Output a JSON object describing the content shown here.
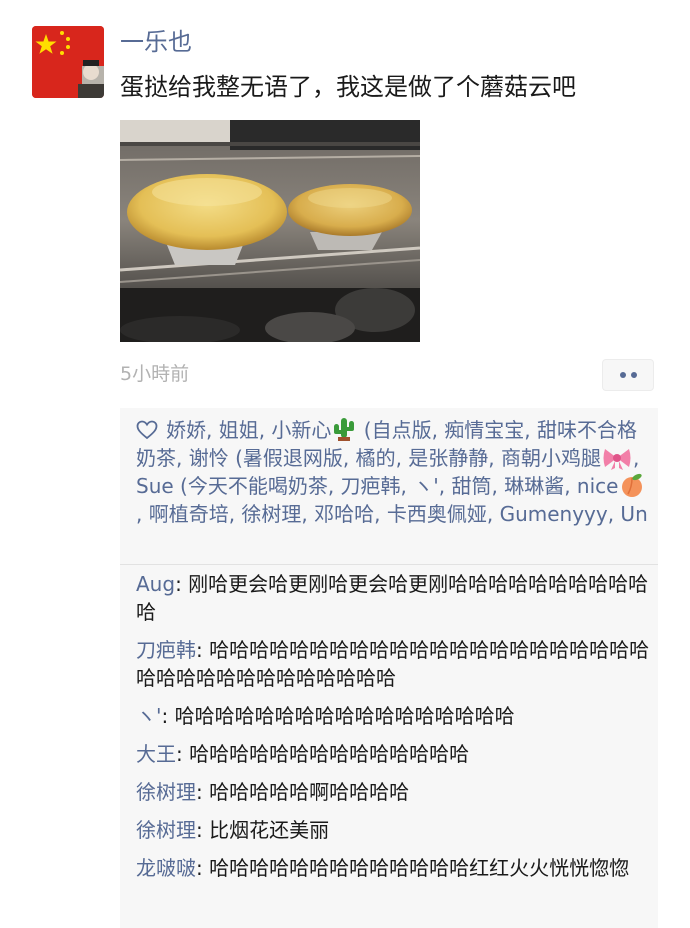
{
  "post": {
    "author": "一乐也",
    "text": "蛋挞给我整无语了，我这是做了个蘑菇云吧",
    "time": "5小時前"
  },
  "likes": {
    "segments": [
      "娇娇, 姐姐, 小新心",
      " (自点版, 痴情宝宝, 甜味不合格奶茶, 谢怜 (暑假退网版, 橘的, 是张静静, 商朝小鸡腿",
      ", Sue (今天不能喝奶茶, 刀疤韩, ヽ', 甜筒, 琳琳酱, nice",
      ", 啊植奇培, 徐树理, 邓哈哈, 卡西奥佩娅, Gumenyyy, Un"
    ]
  },
  "comments": [
    {
      "name": "Aug",
      "sep": ": ",
      "text": "刚哈更会哈更刚哈更会哈更刚哈哈哈哈哈哈哈哈哈哈哈"
    },
    {
      "name": "刀疤韩",
      "sep": ": ",
      "text": "哈哈哈哈哈哈哈哈哈哈哈哈哈哈哈哈哈哈哈哈哈哈哈哈哈哈哈哈哈哈哈哈哈哈哈"
    },
    {
      "name": "ヽ'",
      "sep": ": ",
      "text": "哈哈哈哈哈哈哈哈哈哈哈哈哈哈哈哈哈"
    },
    {
      "name": "大王",
      "sep": ": ",
      "text": "哈哈哈哈哈哈哈哈哈哈哈哈哈哈"
    },
    {
      "name": "徐树理",
      "sep": ": ",
      "text": "哈哈哈哈哈啊哈哈哈哈"
    },
    {
      "name": "徐树理",
      "sep": ": ",
      "text": "比烟花还美丽"
    },
    {
      "name": "龙啵啵",
      "sep": ": ",
      "text": "哈哈哈哈哈哈哈哈哈哈哈哈哈红红火火恍恍惚惚"
    }
  ],
  "icons": {
    "heart": "heart-outline-icon",
    "cactus": "cactus-emoji",
    "ribbon": "ribbon-emoji",
    "peach": "peach-emoji",
    "more": "more-dots-icon"
  },
  "colors": {
    "link": "#576b95",
    "text": "#1a1a1a",
    "time": "#b2b2b2",
    "panel": "#f7f7f7",
    "avatar_bg": "#d8261c"
  }
}
